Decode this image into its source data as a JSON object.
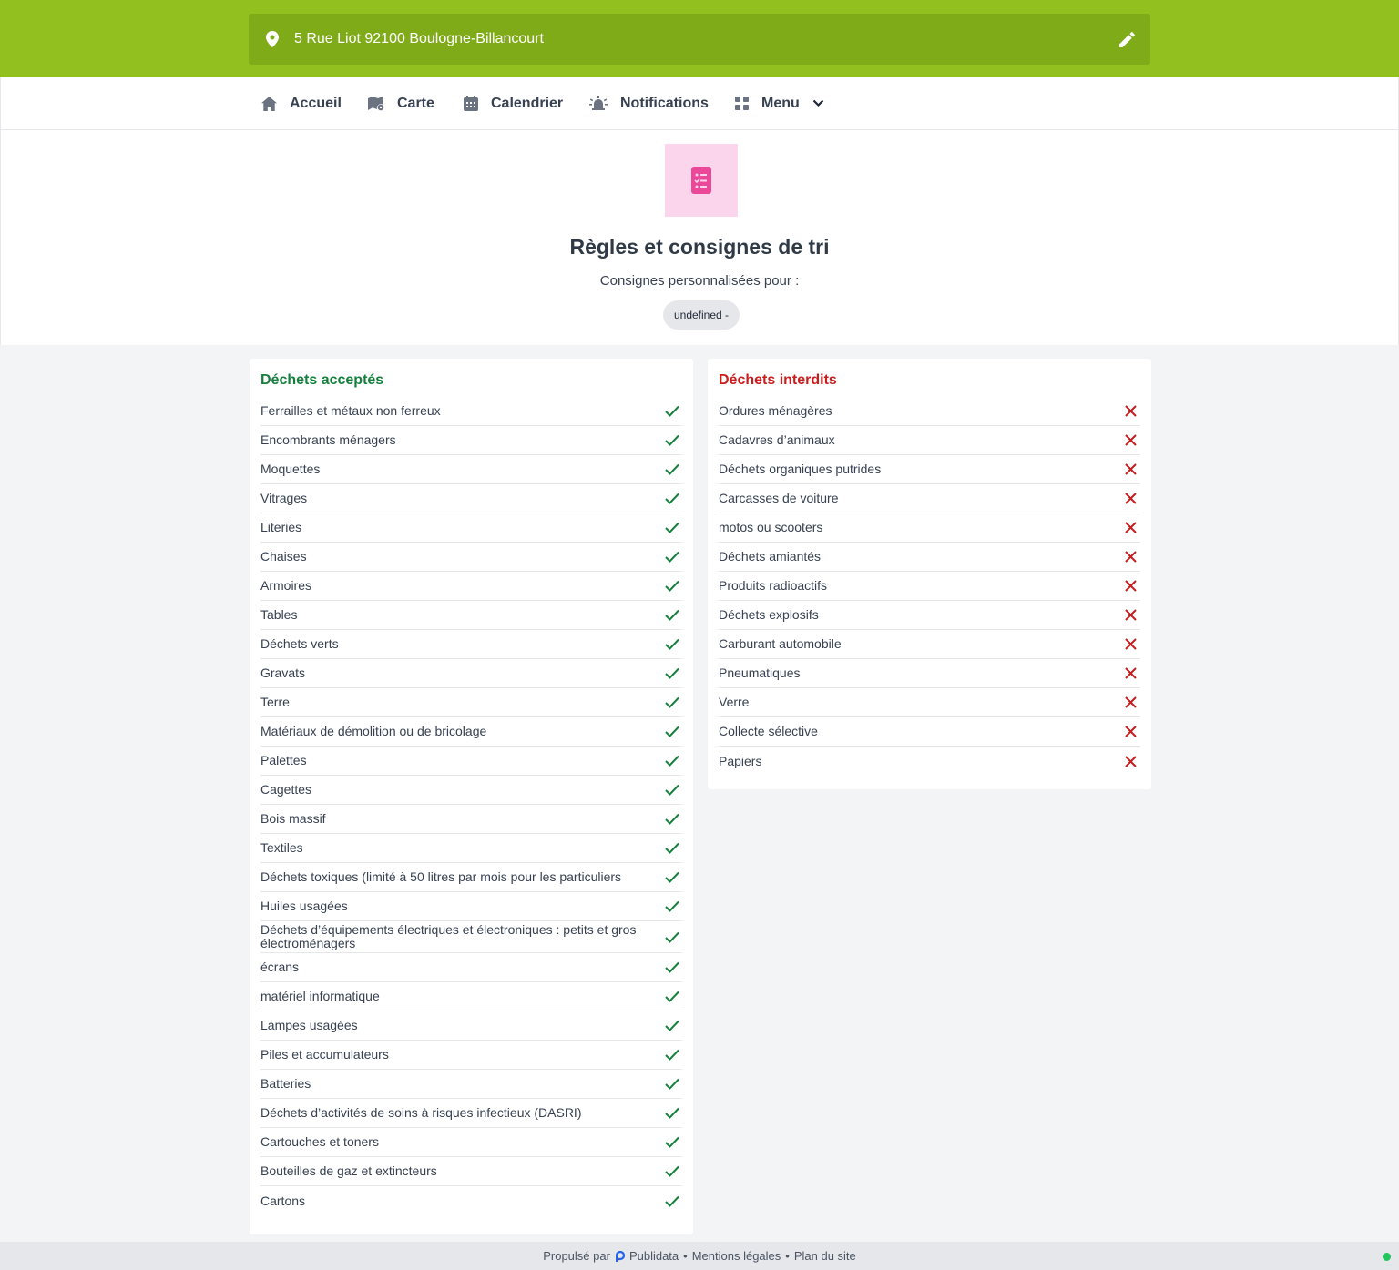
{
  "header": {
    "address": "5 Rue Liot 92100 Boulogne-Billancourt",
    "pin_icon": "map-pin-icon",
    "edit_icon": "pencil-icon"
  },
  "nav": {
    "items": [
      {
        "label": "Accueil",
        "icon": "home-icon"
      },
      {
        "label": "Carte",
        "icon": "map-icon"
      },
      {
        "label": "Calendrier",
        "icon": "calendar-icon"
      },
      {
        "label": "Notifications",
        "icon": "alarm-bell-icon"
      },
      {
        "label": "Menu",
        "icon": "grid-icon"
      }
    ]
  },
  "hero": {
    "icon": "checklist-icon",
    "title": "Règles et consignes de tri",
    "subtitle": "Consignes personnalisées pour :",
    "chip": "undefined -"
  },
  "accepted": {
    "title": "Déchets acceptés",
    "items": [
      "Ferrailles et métaux non ferreux",
      "Encombrants ménagers",
      "Moquettes",
      "Vitrages",
      "Literies",
      "Chaises",
      "Armoires",
      "Tables",
      "Déchets verts",
      "Gravats",
      "Terre",
      "Matériaux de démolition ou de bricolage",
      "Palettes",
      "Cagettes",
      "Bois massif",
      "Textiles",
      "Déchets toxiques (limité à 50 litres par mois pour les particuliers",
      "Huiles usagées",
      "Déchets d’équipements électriques et électroniques : petits et gros électroménagers",
      "écrans",
      "matériel informatique",
      "Lampes usagées",
      "Piles et accumulateurs",
      "Batteries",
      "Déchets d’activités de soins à risques infectieux (DASRI)",
      "Cartouches et toners",
      "Bouteilles de gaz et extincteurs",
      "Cartons"
    ]
  },
  "forbidden": {
    "title": "Déchets interdits",
    "items": [
      "Ordures ménagères",
      "Cadavres d’animaux",
      "Déchets organiques putrides",
      "Carcasses de voiture",
      "motos ou scooters",
      "Déchets amiantés",
      "Produits radioactifs",
      "Déchets explosifs",
      "Carburant automobile",
      "Pneumatiques",
      "Verre",
      "Collecte sélective",
      "Papiers"
    ]
  },
  "footer": {
    "powered_by": "Propulsé par",
    "brand": "Publidata",
    "legal": "Mentions légales",
    "sitemap": "Plan du site",
    "separator": "•"
  },
  "colors": {
    "brand_green": "#92c01f",
    "accepted_green": "#15803d",
    "forbidden_red": "#c81e1e",
    "hero_icon_bg": "#fbd5ec",
    "hero_icon_fg": "#ec4899"
  }
}
